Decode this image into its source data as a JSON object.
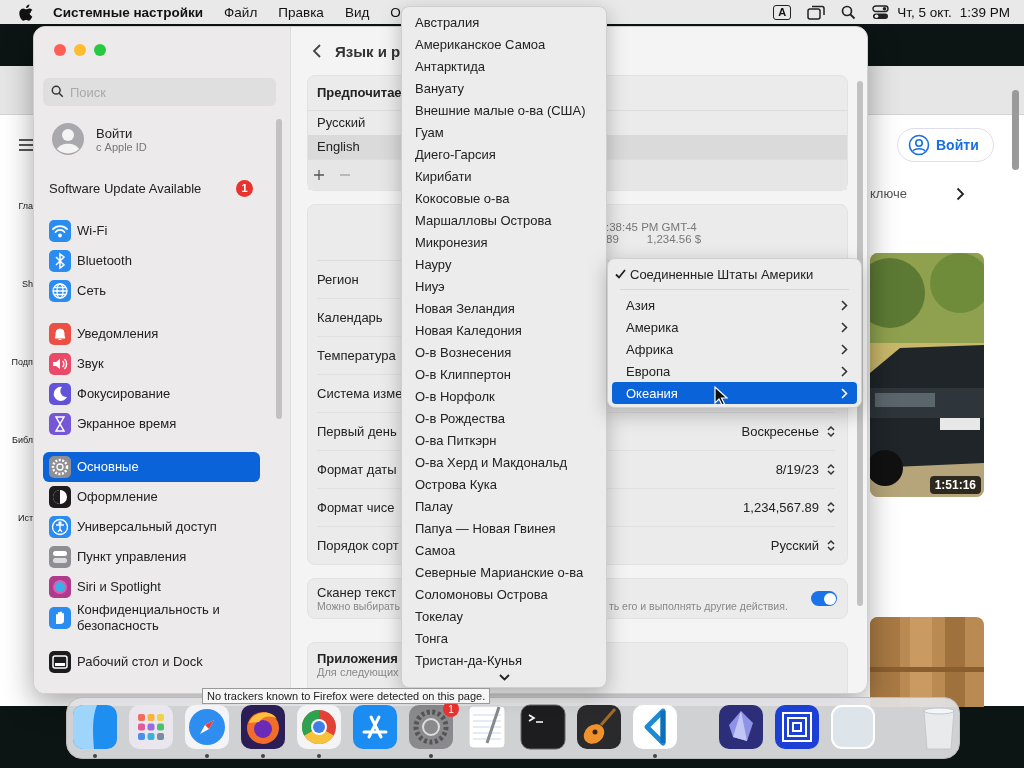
{
  "menu_bar": {
    "app_name": "Системные настройки",
    "menus": [
      "Файл",
      "Правка",
      "Вид",
      "О"
    ],
    "input_source": "A",
    "date": "Чт, 5 окт.",
    "time": "1:39 PM"
  },
  "browser_window": {
    "side_items": [
      "Гла",
      "Sh",
      "Подп",
      "Библ",
      "Ист"
    ],
    "sign_in": "Войти",
    "nav_text": "ключе",
    "video_duration": "1:51:16",
    "tooltip": "No trackers known to Firefox were detected on this page."
  },
  "settings": {
    "search_placeholder": "Поиск",
    "account": {
      "title": "Войти",
      "subtitle": "с Apple ID"
    },
    "update": {
      "label": "Software Update Available",
      "badge": "1"
    },
    "sidebar_groups": [
      [
        {
          "label": "Wi-Fi",
          "kind": "wifi",
          "color": "#2a8cf0",
          "selected": false
        },
        {
          "label": "Bluetooth",
          "kind": "bluetooth",
          "color": "#2a8cf0",
          "selected": false
        },
        {
          "label": "Сеть",
          "kind": "globe",
          "color": "#2a8cf0",
          "selected": false
        }
      ],
      [
        {
          "label": "Уведомления",
          "kind": "bell",
          "color": "#ee4f45",
          "selected": false
        },
        {
          "label": "Звук",
          "kind": "speaker",
          "color": "#ea4a68",
          "selected": false
        },
        {
          "label": "Фокусирование",
          "kind": "moon",
          "color": "#6253d9",
          "selected": false
        },
        {
          "label": "Экранное время",
          "kind": "hourglass",
          "color": "#7556d6",
          "selected": false
        }
      ],
      [
        {
          "label": "Основные",
          "kind": "gear",
          "color": "#8e8e93",
          "selected": true
        },
        {
          "label": "Оформление",
          "kind": "contrast",
          "color": "#1c1c1e",
          "selected": false
        },
        {
          "label": "Универсальный доступ",
          "kind": "accessibility",
          "color": "#2a8cf0",
          "selected": false
        },
        {
          "label": "Пункт управления",
          "kind": "switches",
          "color": "#8e8e93",
          "selected": false
        },
        {
          "label": "Siri и Spotlight",
          "kind": "orb",
          "color": "#b03a8c",
          "selected": false
        },
        {
          "label": "Конфиденциальность и безопасность",
          "kind": "hand",
          "color": "#2a8cf0",
          "selected": false
        }
      ],
      [
        {
          "label": "Рабочий стол и Dock",
          "kind": "dock",
          "color": "#1c1c1e",
          "selected": false
        }
      ]
    ],
    "title": "Язык и р",
    "languages": {
      "heading": "Предпочитае",
      "items": [
        {
          "label": "Русский",
          "selected": false
        },
        {
          "label": "English",
          "selected": true
        }
      ]
    },
    "preview": {
      "line_1": ":38:45 PM GMT-4",
      "line_2_start": "89",
      "line_2_end": "1,234.56 $"
    },
    "format_rows": [
      {
        "label": "Регион"
      },
      {
        "label": "Календарь"
      },
      {
        "label": "Температура"
      },
      {
        "label": "Система изме"
      },
      {
        "label": "Первый день",
        "value": "Воскресенье"
      },
      {
        "label": "Формат даты",
        "value": "8/19/23"
      },
      {
        "label": "Формат чисе",
        "value": "1,234,567.89"
      },
      {
        "label": "Порядок сорт",
        "value": "Русский"
      }
    ],
    "live_text": {
      "title": "Сканер текст",
      "description_start": "Можно выбирать",
      "description_end": "ть его и выполнять другие действия.",
      "on": true
    },
    "apps": {
      "title": "Приложения",
      "description": "Для следующих"
    }
  },
  "region_menu": {
    "items": [
      "Австралия",
      "Американское Самоа",
      "Антарктида",
      "Вануату",
      "Внешние малые о-ва (США)",
      "Гуам",
      "Диего-Гарсия",
      "Кирибати",
      "Кокосовые о-ва",
      "Маршалловы Острова",
      "Микронезия",
      "Науру",
      "Ниуэ",
      "Новая Зеландия",
      "Новая Каледония",
      "О-в Вознесения",
      "О-в Клиппертон",
      "О-в Норфолк",
      "О-в Рождества",
      "О-ва Питкэрн",
      "О-ва Херд и Макдональд",
      "Острова Кука",
      "Палау",
      "Папуа — Новая Гвинея",
      "Самоа",
      "Северные Марианские о-ва",
      "Соломоновы Острова",
      "Токелау",
      "Тонга",
      "Тристан-да-Кунья"
    ]
  },
  "region_submenu": {
    "current": {
      "label": "Соединенные Штаты Америки",
      "checked": true
    },
    "items": [
      {
        "label": "Азия",
        "selected": false
      },
      {
        "label": "Америка",
        "selected": false
      },
      {
        "label": "Африка",
        "selected": false
      },
      {
        "label": "Европа",
        "selected": false
      },
      {
        "label": "Океания",
        "selected": true
      }
    ]
  },
  "dock": {
    "apps": [
      {
        "kind": "finder",
        "running": true
      },
      {
        "kind": "launcher",
        "running": false
      },
      {
        "kind": "compass",
        "running": true
      },
      {
        "kind": "fox",
        "running": true
      },
      {
        "kind": "ring",
        "running": true
      },
      {
        "kind": "store",
        "running": false
      },
      {
        "kind": "settings",
        "running": true,
        "badge": "1"
      },
      {
        "kind": "notepad",
        "running": false
      },
      {
        "kind": "terminal",
        "running": false
      },
      {
        "kind": "guitar",
        "running": false
      },
      {
        "kind": "code",
        "running": true
      },
      {
        "kind": "divider"
      },
      {
        "kind": "crystal",
        "running": false
      },
      {
        "kind": "squares",
        "running": false
      },
      {
        "kind": "blank",
        "running": false
      },
      {
        "kind": "divider"
      },
      {
        "kind": "trash",
        "running": false
      }
    ]
  }
}
